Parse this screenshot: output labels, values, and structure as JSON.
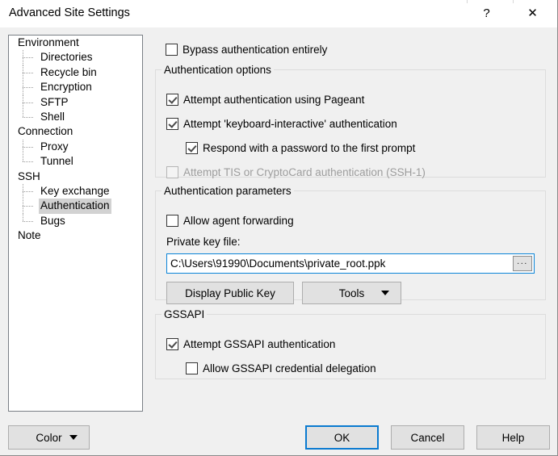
{
  "window": {
    "title": "Advanced Site Settings",
    "help_icon_label": "?",
    "close_icon_label": "✕"
  },
  "tree": {
    "nodes": [
      {
        "label": "Environment",
        "level": 0,
        "selected": false,
        "last": false
      },
      {
        "label": "Directories",
        "level": 1,
        "selected": false,
        "last": false
      },
      {
        "label": "Recycle bin",
        "level": 1,
        "selected": false,
        "last": false
      },
      {
        "label": "Encryption",
        "level": 1,
        "selected": false,
        "last": false
      },
      {
        "label": "SFTP",
        "level": 1,
        "selected": false,
        "last": false
      },
      {
        "label": "Shell",
        "level": 1,
        "selected": false,
        "last": true
      },
      {
        "label": "Connection",
        "level": 0,
        "selected": false,
        "last": false
      },
      {
        "label": "Proxy",
        "level": 1,
        "selected": false,
        "last": false
      },
      {
        "label": "Tunnel",
        "level": 1,
        "selected": false,
        "last": true
      },
      {
        "label": "SSH",
        "level": 0,
        "selected": false,
        "last": false
      },
      {
        "label": "Key exchange",
        "level": 1,
        "selected": false,
        "last": false
      },
      {
        "label": "Authentication",
        "level": 1,
        "selected": true,
        "last": false
      },
      {
        "label": "Bugs",
        "level": 1,
        "selected": false,
        "last": true
      },
      {
        "label": "Note",
        "level": 0,
        "selected": false,
        "last": false
      }
    ]
  },
  "main": {
    "bypass": {
      "label": "Bypass authentication entirely",
      "checked": false,
      "enabled": true
    },
    "auth_options": {
      "legend": "Authentication options",
      "items": [
        {
          "label": "Attempt authentication using Pageant",
          "checked": true,
          "enabled": true,
          "indent": false
        },
        {
          "label": "Attempt 'keyboard-interactive' authentication",
          "checked": true,
          "enabled": true,
          "indent": false
        },
        {
          "label": "Respond with a password to the first prompt",
          "checked": true,
          "enabled": true,
          "indent": true
        },
        {
          "label": "Attempt TIS or CryptoCard authentication (SSH-1)",
          "checked": false,
          "enabled": false,
          "indent": false
        }
      ]
    },
    "auth_params": {
      "legend": "Authentication parameters",
      "agent_forwarding": {
        "label": "Allow agent forwarding",
        "checked": false,
        "enabled": true
      },
      "private_key_label": "Private key file:",
      "private_key_value": "C:\\Users\\91990\\Documents\\private_root.ppk",
      "private_key_placeholder": "",
      "browse_label": "...",
      "display_public_key_label": "Display Public Key",
      "tools_label": "Tools"
    },
    "gssapi": {
      "legend": "GSSAPI",
      "items": [
        {
          "label": "Attempt GSSAPI authentication",
          "checked": true,
          "enabled": true,
          "indent": false
        },
        {
          "label": "Allow GSSAPI credential delegation",
          "checked": false,
          "enabled": true,
          "indent": true
        }
      ]
    }
  },
  "footer": {
    "color_label": "Color",
    "ok_label": "OK",
    "cancel_label": "Cancel",
    "help_label": "Help"
  },
  "colors": {
    "dialog_background": "#f0f0f0",
    "titlebar_background": "#ffffff",
    "focus_accent": "#0a7ad0",
    "tree_selection": "#d2d2d2",
    "disabled_text": "#9d9d9d",
    "button_face": "#e1e1e1",
    "group_border": "#dcdcdc"
  }
}
